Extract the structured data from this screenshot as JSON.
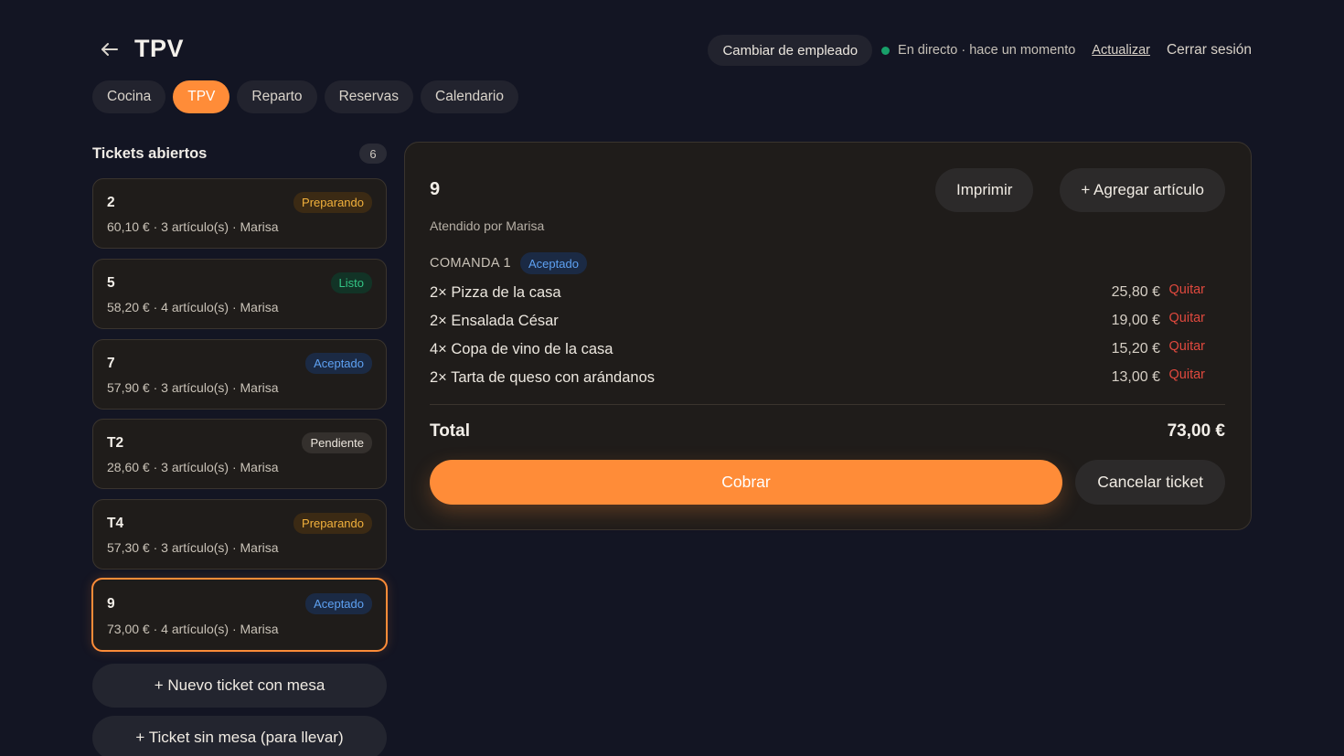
{
  "header": {
    "title": "TPV",
    "switch_employee": "Cambiar de empleado",
    "live_status": "En directo · hace un momento",
    "refresh": "Actualizar",
    "logout": "Cerrar sesión",
    "back_icon": "arrow-left-icon"
  },
  "tabs": [
    {
      "label": "Cocina",
      "active": false
    },
    {
      "label": "TPV",
      "active": true
    },
    {
      "label": "Reparto",
      "active": false
    },
    {
      "label": "Reservas",
      "active": false
    },
    {
      "label": "Calendario",
      "active": false
    }
  ],
  "open_tickets": {
    "title": "Tickets abiertos",
    "count": "6",
    "tickets": [
      {
        "number": "2",
        "meta": "60,10 € · 3 artículo(s) · Marisa",
        "status": "Preparando"
      },
      {
        "number": "5",
        "meta": "58,20 € · 4 artículo(s) · Marisa",
        "status": "Listo"
      },
      {
        "number": "7",
        "meta": "57,90 € · 3 artículo(s) · Marisa",
        "status": "Aceptado"
      },
      {
        "number": "T2",
        "meta": "28,60 € · 3 artículo(s) · Marisa",
        "status": "Pendiente"
      },
      {
        "number": "T4",
        "meta": "57,30 € · 3 artículo(s) · Marisa",
        "status": "Preparando"
      },
      {
        "number": "9",
        "meta": "73,00 € · 4 artículo(s) · Marisa",
        "status": "Aceptado"
      }
    ],
    "new_table_ticket": "+ Nuevo ticket con mesa",
    "takeaway_ticket": "+ Ticket sin mesa (para llevar)"
  },
  "detail": {
    "number": "9",
    "attended_by": "Atendido por Marisa",
    "print": "Imprimir",
    "add_item": "+ Agregar artículo",
    "order_label": "COMANDA 1",
    "order_status": "Aceptado",
    "items": [
      {
        "name": "2× Pizza de la casa",
        "price": "25,80 €",
        "remove": "Quitar"
      },
      {
        "name": "2× Ensalada César",
        "price": "19,00 €",
        "remove": "Quitar"
      },
      {
        "name": "4× Copa de vino de la casa",
        "price": "15,20 €",
        "remove": "Quitar"
      },
      {
        "name": "2× Tarta de queso con arándanos",
        "price": "13,00 €",
        "remove": "Quitar"
      }
    ],
    "total_label": "Total",
    "total_value": "73,00 €",
    "charge": "Cobrar",
    "cancel": "Cancelar ticket"
  },
  "colors": {
    "accent": "#ff8c38",
    "background": "#131523",
    "live": "#18a06a",
    "remove": "#e0493e"
  }
}
